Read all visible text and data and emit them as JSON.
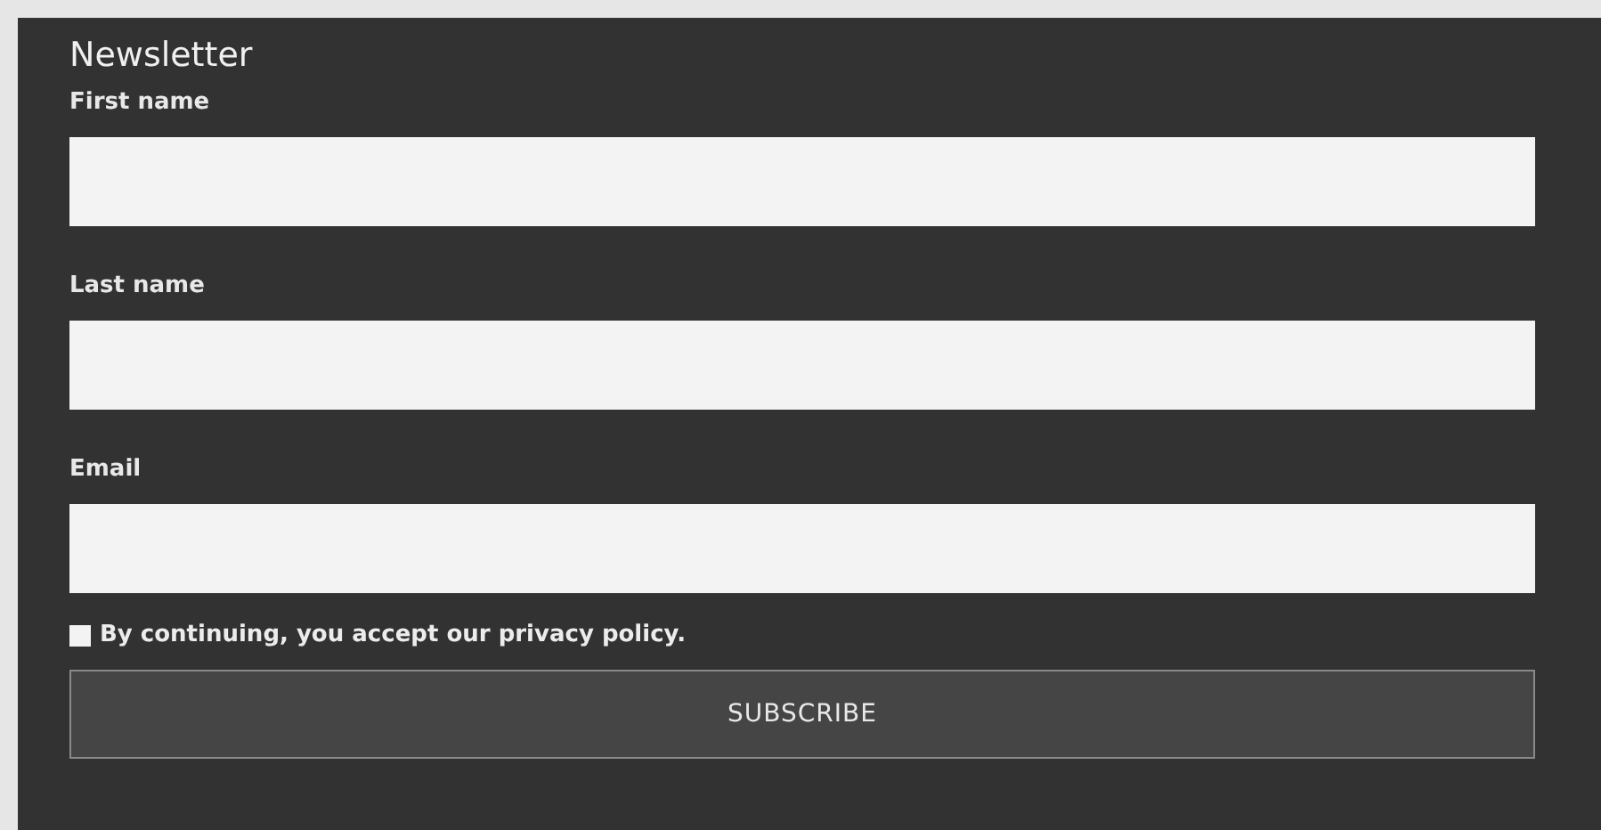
{
  "title": "Newsletter",
  "fields": [
    {
      "label": "First name"
    },
    {
      "label": "Last name"
    },
    {
      "label": "Email"
    }
  ],
  "consent": {
    "label": "By continuing, you accept our privacy policy.",
    "checked": false
  },
  "button": "SUBSCRIBE"
}
